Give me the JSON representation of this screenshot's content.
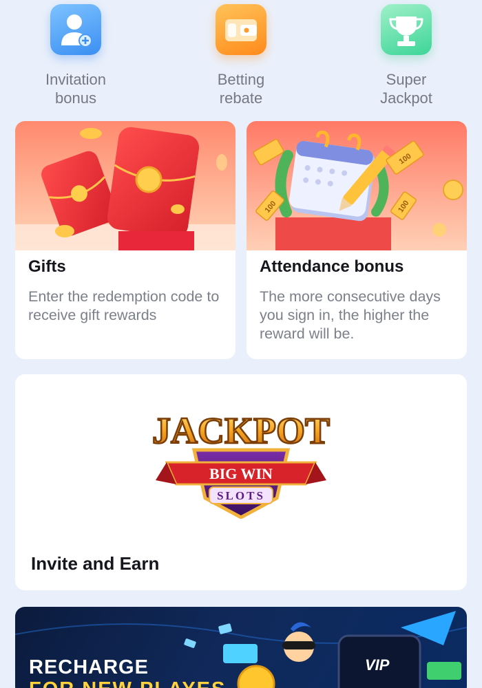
{
  "quick_actions": [
    {
      "label_line1": "Invitation",
      "label_line2": "bonus",
      "icon": "add-user-icon",
      "color": "#4a9af5"
    },
    {
      "label_line1": "Betting",
      "label_line2": "rebate",
      "icon": "wallet-icon",
      "color": "#ff9a26"
    },
    {
      "label_line1": "Super",
      "label_line2": "Jackpot",
      "icon": "trophy-icon",
      "color": "#45d89d"
    }
  ],
  "cards": {
    "gifts": {
      "title": "Gifts",
      "description": "Enter the redemption code to receive gift rewards",
      "illustration": "red-envelope-icon"
    },
    "attendance": {
      "title": "Attendance bonus",
      "description": "The more consecutive days you sign in, the higher the reward will be.",
      "illustration": "calendar-icon",
      "ticket_label": "100"
    },
    "invite": {
      "title": "Invite and Earn",
      "logo_text_1": "JACKPOT",
      "logo_text_2": "BIG WIN",
      "logo_text_3": "SLOTS"
    }
  },
  "banner": {
    "line1": "RECHARGE",
    "line2": "FOR NEW PLAYES",
    "badge": "VIP"
  },
  "colors": {
    "background": "#eaf0fb",
    "card": "#ffffff",
    "title": "#15171c",
    "text_muted": "#7b8089",
    "accent_red": "#f25b4a"
  }
}
